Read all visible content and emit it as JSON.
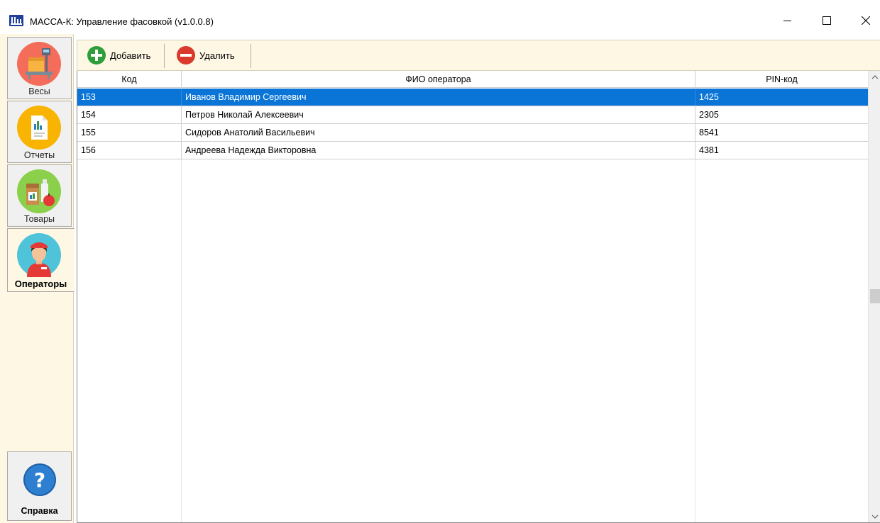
{
  "window": {
    "title": "МАССА-К: Управление фасовкой (v1.0.0.8)",
    "controls": [
      "minimize-icon",
      "maximize-icon",
      "close-icon"
    ]
  },
  "sidebar": {
    "items": [
      {
        "label": "Весы",
        "icon": "scale-icon",
        "color": "#f46d5a",
        "active": false
      },
      {
        "label": "Отчеты",
        "icon": "report-icon",
        "color": "#f8b400",
        "active": false
      },
      {
        "label": "Товары",
        "icon": "goods-icon",
        "color": "#8bd04a",
        "active": false
      },
      {
        "label": "Операторы",
        "icon": "operator-icon",
        "color": "#4fc3d9",
        "active": true
      }
    ],
    "help": {
      "label": "Справка",
      "icon": "help-icon",
      "color": "#1d5fa8"
    }
  },
  "toolbar": {
    "add_label": "Добавить",
    "delete_label": "Удалить",
    "add_color": "#2e9e3a",
    "delete_color": "#d93a2b"
  },
  "grid": {
    "columns": [
      "Код",
      "ФИО оператора",
      "PIN-код"
    ],
    "rows": [
      {
        "code": "153",
        "name": "Иванов Владимир Сергеевич",
        "pin": "1425",
        "selected": true
      },
      {
        "code": "154",
        "name": "Петров Николай Алексеевич",
        "pin": "2305",
        "selected": false
      },
      {
        "code": "155",
        "name": "Сидоров Анатолий Васильевич",
        "pin": "8541",
        "selected": false
      },
      {
        "code": "156",
        "name": "Андреева Надежда Викторовна",
        "pin": "4381",
        "selected": false
      }
    ],
    "selection_color": "#0a75d6"
  }
}
